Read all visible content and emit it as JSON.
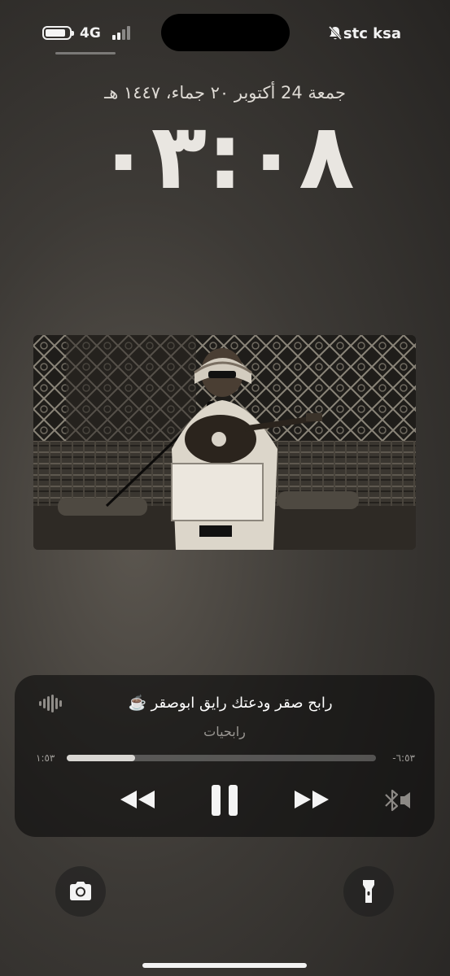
{
  "status_bar": {
    "network": "4G",
    "carrier": "stc ksa",
    "icons": [
      "battery-icon",
      "signal-bars-icon",
      "silent-bell-icon"
    ]
  },
  "lock_screen": {
    "date": "جمعة 24 أكتوبر ٢٠ جماء، ١٤٤٧ هـ",
    "time": "٠٣:٠٨"
  },
  "now_playing": {
    "title": "رابح صقر ودعتك رايق ابوصقر ☕️",
    "artist": "رابحيات",
    "elapsed": "١:٥٣",
    "remaining": "-٦:٥٣",
    "progress": 0.22,
    "controls": [
      "rewind-icon",
      "pause-icon",
      "fast-forward-icon",
      "bluetooth-output-icon"
    ]
  },
  "quick_actions": {
    "left": "camera-icon",
    "right": "flashlight-icon"
  }
}
